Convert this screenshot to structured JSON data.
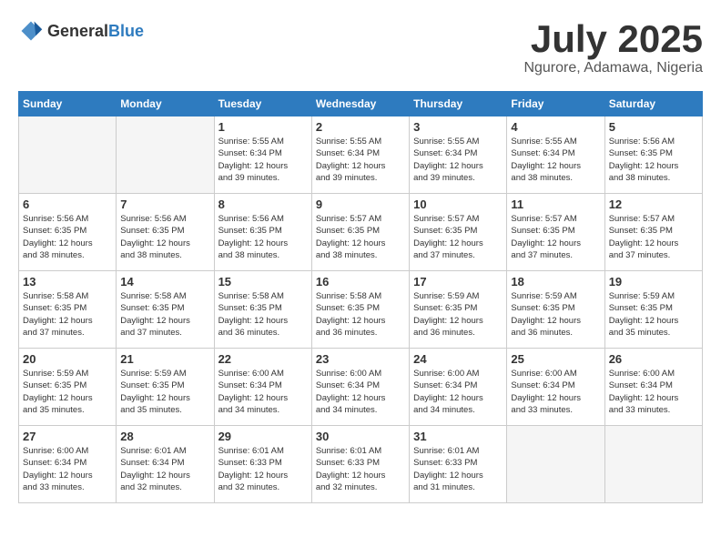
{
  "logo": {
    "text_general": "General",
    "text_blue": "Blue"
  },
  "title": "July 2025",
  "subtitle": "Ngurore, Adamawa, Nigeria",
  "days_header": [
    "Sunday",
    "Monday",
    "Tuesday",
    "Wednesday",
    "Thursday",
    "Friday",
    "Saturday"
  ],
  "weeks": [
    [
      {
        "day": "",
        "info": ""
      },
      {
        "day": "",
        "info": ""
      },
      {
        "day": "1",
        "info": "Sunrise: 5:55 AM\nSunset: 6:34 PM\nDaylight: 12 hours\nand 39 minutes."
      },
      {
        "day": "2",
        "info": "Sunrise: 5:55 AM\nSunset: 6:34 PM\nDaylight: 12 hours\nand 39 minutes."
      },
      {
        "day": "3",
        "info": "Sunrise: 5:55 AM\nSunset: 6:34 PM\nDaylight: 12 hours\nand 39 minutes."
      },
      {
        "day": "4",
        "info": "Sunrise: 5:55 AM\nSunset: 6:34 PM\nDaylight: 12 hours\nand 38 minutes."
      },
      {
        "day": "5",
        "info": "Sunrise: 5:56 AM\nSunset: 6:35 PM\nDaylight: 12 hours\nand 38 minutes."
      }
    ],
    [
      {
        "day": "6",
        "info": "Sunrise: 5:56 AM\nSunset: 6:35 PM\nDaylight: 12 hours\nand 38 minutes."
      },
      {
        "day": "7",
        "info": "Sunrise: 5:56 AM\nSunset: 6:35 PM\nDaylight: 12 hours\nand 38 minutes."
      },
      {
        "day": "8",
        "info": "Sunrise: 5:56 AM\nSunset: 6:35 PM\nDaylight: 12 hours\nand 38 minutes."
      },
      {
        "day": "9",
        "info": "Sunrise: 5:57 AM\nSunset: 6:35 PM\nDaylight: 12 hours\nand 38 minutes."
      },
      {
        "day": "10",
        "info": "Sunrise: 5:57 AM\nSunset: 6:35 PM\nDaylight: 12 hours\nand 37 minutes."
      },
      {
        "day": "11",
        "info": "Sunrise: 5:57 AM\nSunset: 6:35 PM\nDaylight: 12 hours\nand 37 minutes."
      },
      {
        "day": "12",
        "info": "Sunrise: 5:57 AM\nSunset: 6:35 PM\nDaylight: 12 hours\nand 37 minutes."
      }
    ],
    [
      {
        "day": "13",
        "info": "Sunrise: 5:58 AM\nSunset: 6:35 PM\nDaylight: 12 hours\nand 37 minutes."
      },
      {
        "day": "14",
        "info": "Sunrise: 5:58 AM\nSunset: 6:35 PM\nDaylight: 12 hours\nand 37 minutes."
      },
      {
        "day": "15",
        "info": "Sunrise: 5:58 AM\nSunset: 6:35 PM\nDaylight: 12 hours\nand 36 minutes."
      },
      {
        "day": "16",
        "info": "Sunrise: 5:58 AM\nSunset: 6:35 PM\nDaylight: 12 hours\nand 36 minutes."
      },
      {
        "day": "17",
        "info": "Sunrise: 5:59 AM\nSunset: 6:35 PM\nDaylight: 12 hours\nand 36 minutes."
      },
      {
        "day": "18",
        "info": "Sunrise: 5:59 AM\nSunset: 6:35 PM\nDaylight: 12 hours\nand 36 minutes."
      },
      {
        "day": "19",
        "info": "Sunrise: 5:59 AM\nSunset: 6:35 PM\nDaylight: 12 hours\nand 35 minutes."
      }
    ],
    [
      {
        "day": "20",
        "info": "Sunrise: 5:59 AM\nSunset: 6:35 PM\nDaylight: 12 hours\nand 35 minutes."
      },
      {
        "day": "21",
        "info": "Sunrise: 5:59 AM\nSunset: 6:35 PM\nDaylight: 12 hours\nand 35 minutes."
      },
      {
        "day": "22",
        "info": "Sunrise: 6:00 AM\nSunset: 6:34 PM\nDaylight: 12 hours\nand 34 minutes."
      },
      {
        "day": "23",
        "info": "Sunrise: 6:00 AM\nSunset: 6:34 PM\nDaylight: 12 hours\nand 34 minutes."
      },
      {
        "day": "24",
        "info": "Sunrise: 6:00 AM\nSunset: 6:34 PM\nDaylight: 12 hours\nand 34 minutes."
      },
      {
        "day": "25",
        "info": "Sunrise: 6:00 AM\nSunset: 6:34 PM\nDaylight: 12 hours\nand 33 minutes."
      },
      {
        "day": "26",
        "info": "Sunrise: 6:00 AM\nSunset: 6:34 PM\nDaylight: 12 hours\nand 33 minutes."
      }
    ],
    [
      {
        "day": "27",
        "info": "Sunrise: 6:00 AM\nSunset: 6:34 PM\nDaylight: 12 hours\nand 33 minutes."
      },
      {
        "day": "28",
        "info": "Sunrise: 6:01 AM\nSunset: 6:34 PM\nDaylight: 12 hours\nand 32 minutes."
      },
      {
        "day": "29",
        "info": "Sunrise: 6:01 AM\nSunset: 6:33 PM\nDaylight: 12 hours\nand 32 minutes."
      },
      {
        "day": "30",
        "info": "Sunrise: 6:01 AM\nSunset: 6:33 PM\nDaylight: 12 hours\nand 32 minutes."
      },
      {
        "day": "31",
        "info": "Sunrise: 6:01 AM\nSunset: 6:33 PM\nDaylight: 12 hours\nand 31 minutes."
      },
      {
        "day": "",
        "info": ""
      },
      {
        "day": "",
        "info": ""
      }
    ]
  ]
}
